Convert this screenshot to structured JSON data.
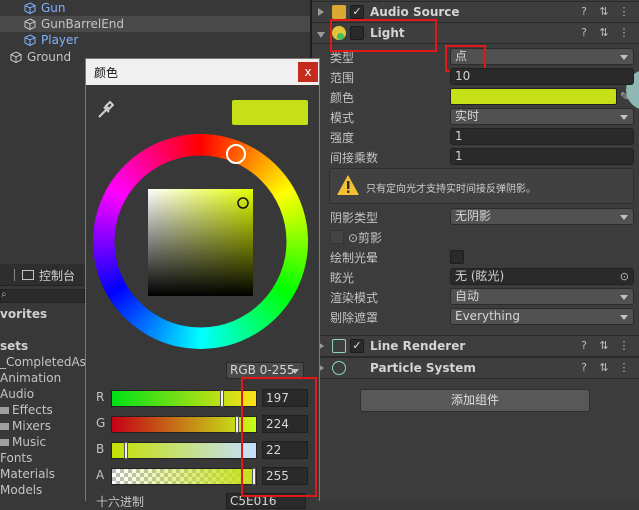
{
  "hierarchy": {
    "items": [
      {
        "label": "Gun",
        "highlight": true
      },
      {
        "label": "GunBarrelEnd",
        "highlight": false
      },
      {
        "label": "Player",
        "highlight": true
      },
      {
        "label": "Ground",
        "highlight": false
      }
    ]
  },
  "project": {
    "console_tab": "控制台",
    "favorites": "vorites",
    "assets": "sets",
    "items": [
      "_CompletedAss",
      "Animation",
      "Audio",
      "Effects",
      "Mixers",
      "Music",
      "Fonts",
      "Materials",
      "Models"
    ]
  },
  "inspector": {
    "components": {
      "audio_source": {
        "title": "Audio Source",
        "checked": "✓"
      },
      "light": {
        "title": "Light",
        "checked": ""
      },
      "line_renderer": {
        "title": "Line Renderer",
        "checked": "✓"
      },
      "particle_system": {
        "title": "Particle System"
      }
    },
    "light_props": {
      "type_label": "类型",
      "type_value": "点",
      "range_label": "范围",
      "range_value": "10",
      "color_label": "颜色",
      "color_value": "#C5E016",
      "mode_label": "模式",
      "mode_value": "实时",
      "intensity_label": "强度",
      "intensity_value": "1",
      "indirect_label": "间接乘数",
      "indirect_value": "1",
      "warning_text": "只有定向光才支持实时间接反弹阴影。",
      "shadow_label": "阴影类型",
      "shadow_value": "无阴影",
      "cookie_label": "⊙剪影",
      "draw_halo_label": "绘制光晕",
      "flare_label": "眩光",
      "flare_value": "无 (眩光)",
      "render_mode_label": "渲染模式",
      "render_mode_value": "自动",
      "culling_label": "剔除遮罩",
      "culling_value": "Everything"
    },
    "add_component": "添加组件"
  },
  "color_picker": {
    "title": "颜色",
    "close": "x",
    "swatch_color": "#C5E016",
    "mode": "RGB 0-255",
    "channels": [
      {
        "label": "R",
        "value": "197",
        "fraction": 0.773
      },
      {
        "label": "G",
        "value": "224",
        "fraction": 0.878
      },
      {
        "label": "B",
        "value": "22",
        "fraction": 0.086
      },
      {
        "label": "A",
        "value": "255",
        "fraction": 1.0
      }
    ],
    "hex_label": "十六进制",
    "hex_value": "C5E016"
  }
}
